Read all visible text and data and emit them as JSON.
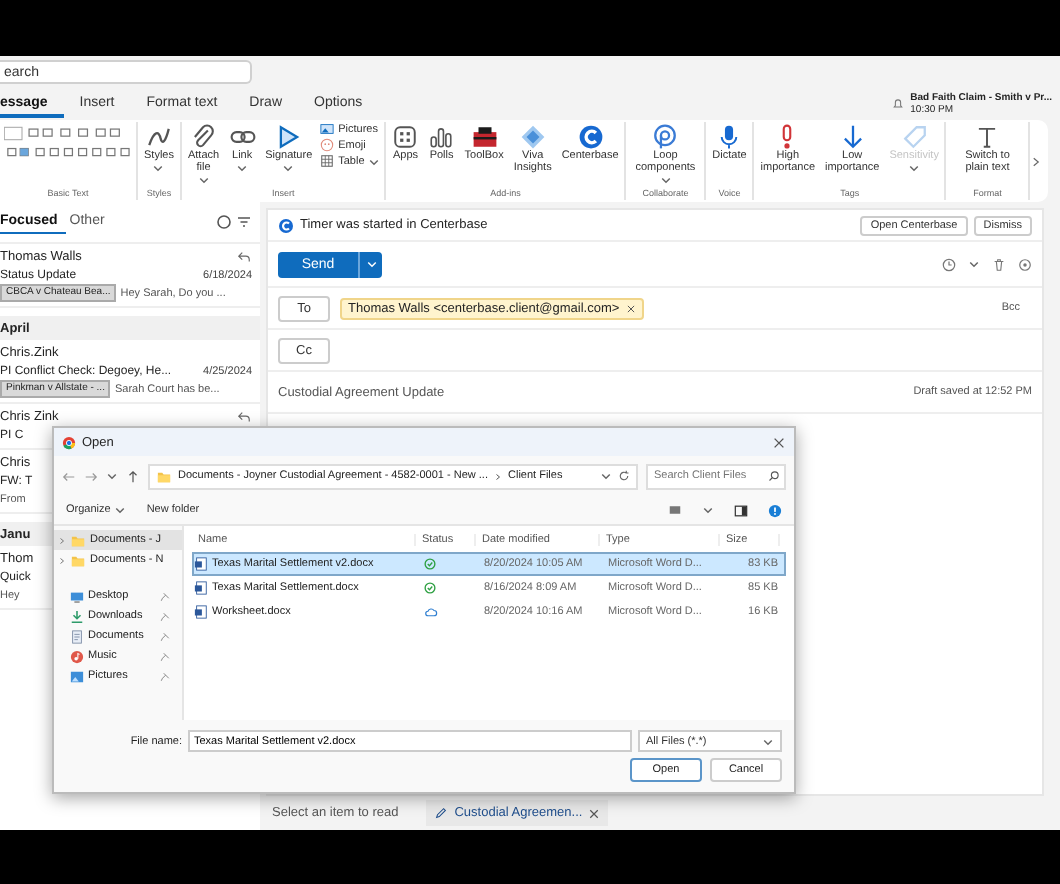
{
  "search": {
    "placeholder": "earch"
  },
  "tabs": [
    {
      "label": "essage",
      "selected": true
    },
    {
      "label": "Insert",
      "selected": false
    },
    {
      "label": "Format text",
      "selected": false
    },
    {
      "label": "Draw",
      "selected": false
    },
    {
      "label": "Options",
      "selected": false
    }
  ],
  "notification": {
    "title": "Bad Faith Claim - Smith v Pr...",
    "time": "10:30 PM"
  },
  "ribbon": {
    "groups": [
      {
        "label": "Basic Text",
        "kind": "formatting"
      },
      {
        "label": "Styles",
        "kind": "buttons",
        "buttons": [
          {
            "label": "Styles",
            "dropdown": true,
            "disabled": false
          }
        ]
      },
      {
        "label": "Insert",
        "kind": "buttons",
        "buttons": [
          {
            "label": "Attach file",
            "dropdown": true,
            "disabled": false
          },
          {
            "label": "Link",
            "dropdown": true,
            "disabled": false
          },
          {
            "label": "Signature",
            "dropdown": true,
            "disabled": false
          }
        ],
        "small_buttons": [
          {
            "label": "Pictures",
            "dropdown": false
          },
          {
            "label": "Emoji",
            "dropdown": false
          },
          {
            "label": "Table",
            "dropdown": true
          }
        ]
      },
      {
        "label": "Add-ins",
        "kind": "buttons",
        "buttons": [
          {
            "label": "Apps",
            "dropdown": false,
            "disabled": false
          },
          {
            "label": "Polls",
            "dropdown": false,
            "disabled": false
          },
          {
            "label": "ToolBox",
            "dropdown": false,
            "disabled": false
          },
          {
            "label": "Viva Insights",
            "dropdown": false,
            "disabled": false
          },
          {
            "label": "Centerbase",
            "dropdown": false,
            "disabled": false
          }
        ]
      },
      {
        "label": "Collaborate",
        "kind": "buttons",
        "buttons": [
          {
            "label": "Loop components",
            "dropdown": true,
            "disabled": false
          }
        ]
      },
      {
        "label": "Voice",
        "kind": "buttons",
        "buttons": [
          {
            "label": "Dictate",
            "dropdown": false,
            "disabled": false
          }
        ]
      },
      {
        "label": "Tags",
        "kind": "buttons",
        "buttons": [
          {
            "label": "High importance",
            "dropdown": false,
            "disabled": false
          },
          {
            "label": "Low importance",
            "dropdown": false,
            "disabled": false
          },
          {
            "label": "Sensitivity",
            "dropdown": true,
            "disabled": true
          }
        ]
      },
      {
        "label": "Format",
        "kind": "buttons",
        "buttons": [
          {
            "label": "Switch to plain text",
            "dropdown": false,
            "disabled": false
          }
        ]
      }
    ]
  },
  "mail_list": {
    "tabs": [
      {
        "label": "Focused",
        "selected": true
      },
      {
        "label": "Other",
        "selected": false
      }
    ],
    "items": [
      {
        "kind": "message",
        "sender": "Thomas Walls",
        "subject": "Status Update",
        "date": "6/18/2024",
        "tag": "CBCA v Chateau Bea...",
        "preview": "Hey Sarah, Do you ...",
        "replied": true
      },
      {
        "kind": "header",
        "label": "April"
      },
      {
        "kind": "message",
        "sender": "Chris.Zink",
        "subject": "PI Conflict Check: Degoey, He...",
        "date": "4/25/2024",
        "tag": "Pinkman v Allstate - ...",
        "preview": "Sarah Court has be...",
        "replied": false
      },
      {
        "kind": "message",
        "sender": "Chris Zink",
        "subject": "PI C",
        "replied": true
      },
      {
        "kind": "message",
        "sender": "Chris",
        "subject": "FW: T",
        "preview": "From",
        "replied": false
      },
      {
        "kind": "header",
        "label": "Janu"
      },
      {
        "kind": "message",
        "sender": "Thom",
        "subject": "Quick",
        "preview": "Hey",
        "replied": false
      }
    ]
  },
  "compose": {
    "banner": {
      "text": "Timer was started in Centerbase",
      "buttons": [
        "Open Centerbase",
        "Dismiss"
      ]
    },
    "send": "Send",
    "to": {
      "label": "To",
      "recipients": [
        "Thomas Walls <centerbase.client@gmail.com>"
      ],
      "bcc": "Bcc"
    },
    "cc": {
      "label": "Cc"
    },
    "subject": "Custodial Agreement Update",
    "draft_status": "Draft saved at 12:52 PM"
  },
  "reading_bar": {
    "text": "Select an item to read",
    "tab": "Custodial Agreemen..."
  },
  "dialog": {
    "title": "Open",
    "path": [
      "Documents - Joyner Custodial Agreement - 4582-0001 - New ...",
      "Client Files"
    ],
    "search": {
      "placeholder": "Search Client Files"
    },
    "toolbar": [
      "Organize",
      "New folder"
    ],
    "nav": [
      {
        "label": "Documents - J",
        "selected": true
      },
      {
        "label": "Documents - N",
        "selected": false
      }
    ],
    "quick_access": [
      {
        "label": "Desktop",
        "pinned": true
      },
      {
        "label": "Downloads",
        "pinned": true
      },
      {
        "label": "Documents",
        "pinned": true
      },
      {
        "label": "Music",
        "pinned": true
      },
      {
        "label": "Pictures",
        "pinned": true
      }
    ],
    "columns": [
      "Name",
      "Status",
      "Date modified",
      "Type",
      "Size"
    ],
    "files": [
      {
        "name": "Texas Marital Settlement v2.docx",
        "kind": "synced",
        "date": "8/20/2024 10:05 AM",
        "type": "Microsoft Word D...",
        "size": "83 KB",
        "selected": true
      },
      {
        "name": "Texas Marital Settlement.docx",
        "kind": "synced",
        "date": "8/16/2024 8:09 AM",
        "type": "Microsoft Word D...",
        "size": "85 KB",
        "selected": false
      },
      {
        "name": "Worksheet.docx",
        "kind": "online",
        "date": "8/20/2024 10:16 AM",
        "type": "Microsoft Word D...",
        "size": "16 KB",
        "selected": false
      }
    ],
    "file_name_label": "File name:",
    "file_name": "Texas Marital Settlement v2.docx",
    "filter": "All Files (*.*)",
    "buttons": [
      "Open",
      "Cancel"
    ]
  }
}
